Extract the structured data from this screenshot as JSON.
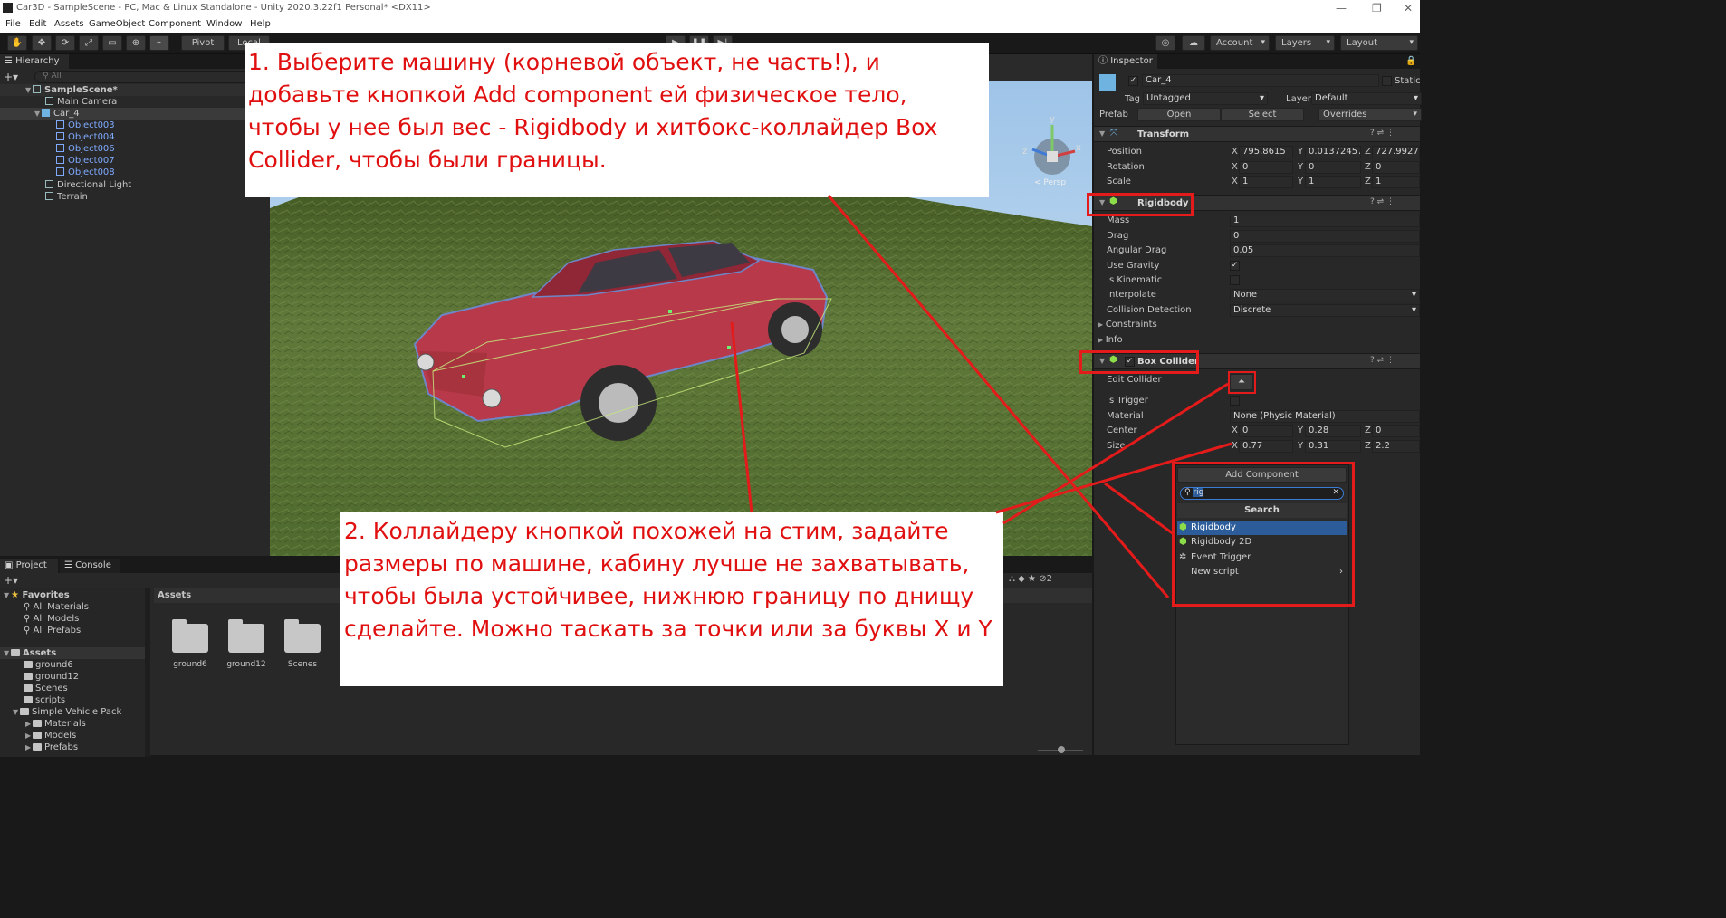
{
  "window": {
    "title": "Car3D - SampleScene - PC, Mac & Linux Standalone - Unity 2020.3.22f1 Personal* <DX11>",
    "buttons": [
      "—",
      "❐",
      "✕"
    ]
  },
  "menu": [
    "File",
    "Edit",
    "Assets",
    "GameObject",
    "Component",
    "Window",
    "Help"
  ],
  "toolbar": {
    "pivot_label": "Pivot",
    "local_label": "Local",
    "account_label": "Account",
    "layers_label": "Layers",
    "layout_label": "Layout"
  },
  "hierarchy": {
    "tab_label": "Hierarchy",
    "search_placeholder": "All",
    "scene": "SampleScene*",
    "items": [
      "Main Camera",
      "Car_4",
      "Object003",
      "Object004",
      "Object006",
      "Object007",
      "Object008",
      "Directional Light",
      "Terrain"
    ]
  },
  "scene_view": {
    "gizmo_y": "y",
    "gizmo_x": "x",
    "gizmo_z": "z",
    "persp_label": "< Persp"
  },
  "inspector": {
    "tab_label": "Inspector",
    "object_name": "Car_4",
    "static_label": "Static",
    "tag_label": "Tag",
    "tag_value": "Untagged",
    "layer_label": "Layer",
    "layer_value": "Default",
    "prefab_label": "Prefab",
    "prefab_open": "Open",
    "prefab_select": "Select",
    "prefab_overrides": "Overrides",
    "transform": {
      "title": "Transform",
      "position_label": "Position",
      "rotation_label": "Rotation",
      "scale_label": "Scale",
      "position": [
        "795.8615",
        "0.01372457",
        "727.9927"
      ],
      "rotation": [
        "0",
        "0",
        "0"
      ],
      "scale": [
        "1",
        "1",
        "1"
      ]
    },
    "rigidbody": {
      "title": "Rigidbody",
      "mass_label": "Mass",
      "mass": "1",
      "drag_label": "Drag",
      "drag": "0",
      "angular_drag_label": "Angular Drag",
      "angular_drag": "0.05",
      "use_gravity_label": "Use Gravity",
      "is_kinematic_label": "Is Kinematic",
      "interpolate_label": "Interpolate",
      "interpolate": "None",
      "collision_label": "Collision Detection",
      "collision": "Discrete",
      "constraints_label": "Constraints",
      "info_label": "Info"
    },
    "box_collider": {
      "title": "Box Collider",
      "edit_label": "Edit Collider",
      "is_trigger_label": "Is Trigger",
      "material_label": "Material",
      "material": "None (Physic Material)",
      "center_label": "Center",
      "size_label": "Size",
      "center": [
        "0",
        "0.28",
        "0"
      ],
      "size": [
        "0.77",
        "0.31",
        "2.2"
      ]
    },
    "axes": [
      "X",
      "Y",
      "Z"
    ],
    "add_component": {
      "button_label": "Add Component",
      "search_value": "rig",
      "search_header": "Search",
      "items": [
        "Rigidbody",
        "Rigidbody 2D",
        "Event Trigger",
        "New script"
      ]
    }
  },
  "project": {
    "tab_project": "Project",
    "tab_console": "Console",
    "favorites_label": "Favorites",
    "favorites": [
      "All Materials",
      "All Models",
      "All Prefabs"
    ],
    "assets_label": "Assets",
    "asset_tree": [
      "ground6",
      "ground12",
      "Scenes",
      "scripts",
      "Simple Vehicle Pack",
      "Materials",
      "Models",
      "Prefabs"
    ],
    "breadcrumb": "Assets",
    "hidden_count": "2",
    "grid_items": [
      "ground6",
      "ground12",
      "Scenes"
    ]
  },
  "notes": {
    "note1": "1. Выберите машину (корневой объект, не часть!), и добавьте кнопкой Add component ей физическое тело, чтобы у нее был вес - Rigidbody и хитбокс-коллайдер Box Collider, чтобы были границы.",
    "note2": "2. Коллайдеру кнопкой похожей на стим, задайте размеры по машине, кабину лучше не захватывать, чтобы была устойчивее, нижнюю границу по днищу сделайте. Можно таскать за точки или за буквы X и Y"
  },
  "colors": {
    "annotation_red": "#e31b1b",
    "selection_blue": "#2c5d9a",
    "car_red": "#b8394a",
    "grass": "#5f7a36",
    "sky": "#b9d6f0"
  }
}
